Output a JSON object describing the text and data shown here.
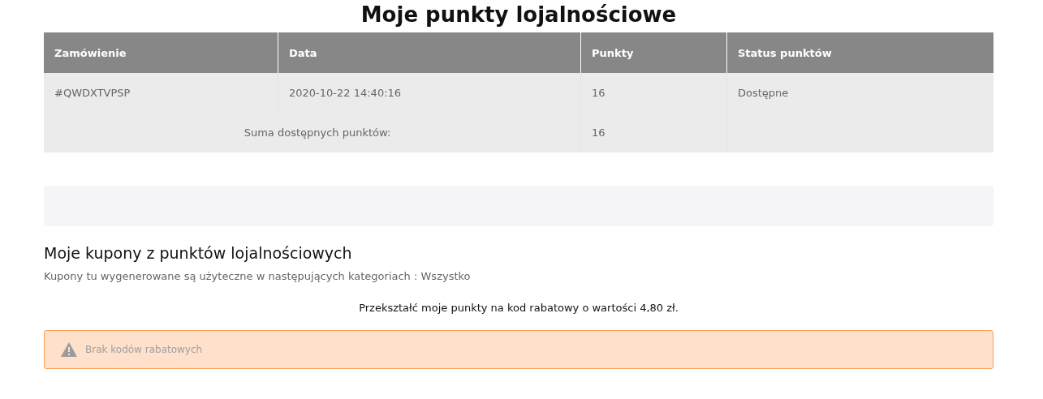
{
  "page_title": "Moje punkty lojalnościowe",
  "table": {
    "columns": [
      "Zamówienie",
      "Data",
      "Punkty",
      "Status punktów"
    ],
    "rows": [
      {
        "order": "#QWDXTVPSP",
        "date": "2020-10-22 14:40:16",
        "points": "16",
        "status": "Dostępne"
      }
    ],
    "total": {
      "label": "Suma dostępnych punktów:",
      "points": "16"
    }
  },
  "coupons": {
    "heading": "Moje kupony z punktów lojalnościowych",
    "description": "Kupony tu wygenerowane są użyteczne w następujących kategoriach : Wszystko",
    "convert_text": "Przekształć moje punkty na kod rabatowy o wartości 4,80 zł.",
    "alert": {
      "kind": "warning",
      "text": "Brak kodów rabatowych"
    }
  }
}
